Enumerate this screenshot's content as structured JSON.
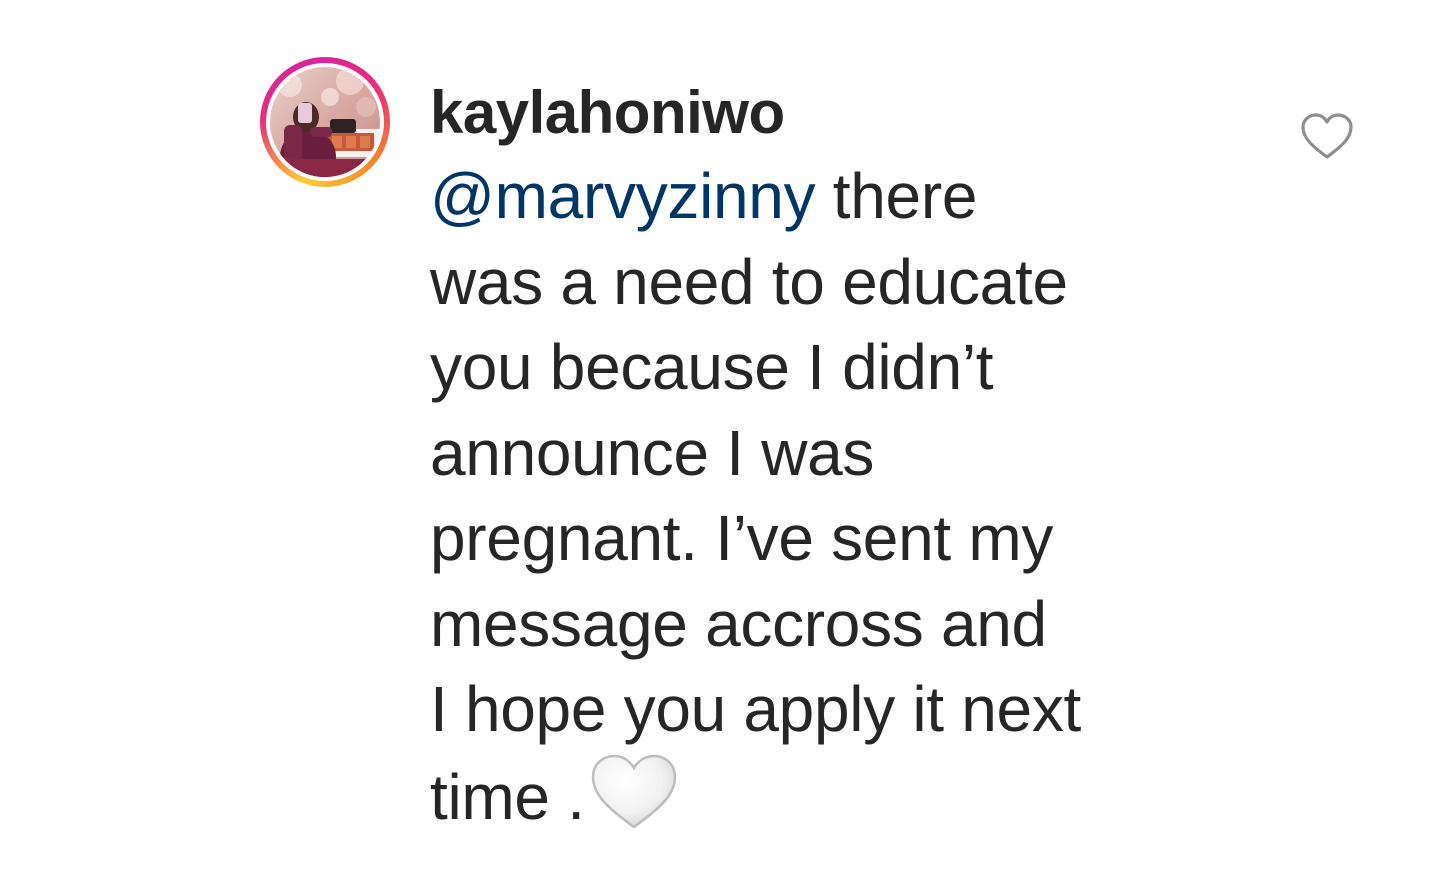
{
  "comment": {
    "username": "kaylahoniwo",
    "mention": "@marvyzinny",
    "lines": [
      " there",
      "was a need to educate",
      "you because I didn’t",
      "announce I was",
      "pregnant. I’ve sent my",
      "message accross and",
      "I hope you apply it next",
      "time ."
    ],
    "emoji": "white-heart",
    "like_icon": "heart-outline-icon"
  },
  "colors": {
    "text": "#262626",
    "mention": "#003569",
    "icon_stroke": "#8e8e8e"
  }
}
